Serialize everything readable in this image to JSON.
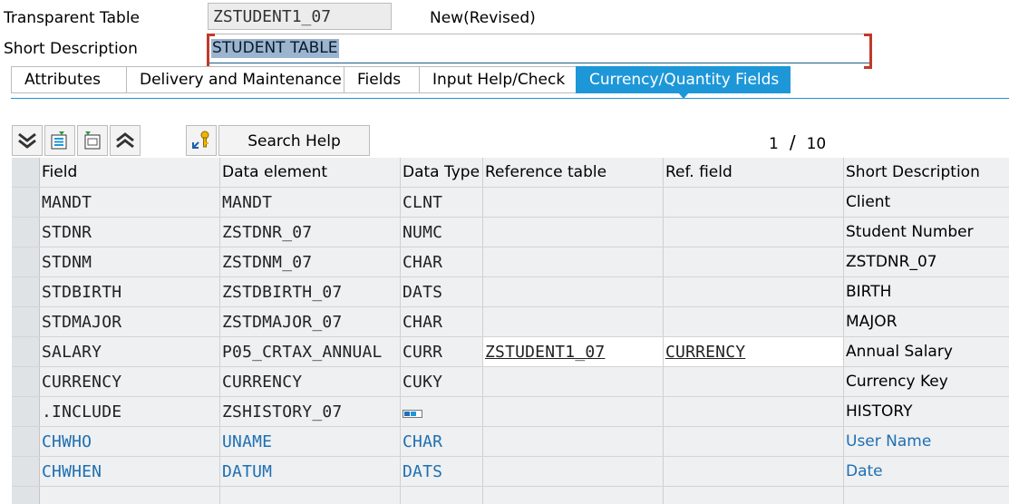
{
  "header": {
    "table_label": "Transparent Table",
    "table_name": "ZSTUDENT1_07",
    "status": "New(Revised)",
    "desc_label": "Short Description",
    "desc_value": "STUDENT TABLE"
  },
  "tabs": [
    {
      "label": "Attributes"
    },
    {
      "label": "Delivery and Maintenance"
    },
    {
      "label": "Fields"
    },
    {
      "label": "Input Help/Check"
    },
    {
      "label": "Currency/Quantity Fields"
    }
  ],
  "toolbar": {
    "search_help": "Search Help",
    "page_current": "1",
    "page_sep": "/",
    "page_total": "10"
  },
  "icons": {
    "collapse_all": "double-chevron-down-icon",
    "insert_row": "insert-row-icon",
    "delete_row": "delete-row-icon",
    "expand_all": "double-chevron-up-icon",
    "search_help": "search-help-key-icon",
    "include": "include-structure-icon"
  },
  "colors": {
    "accent": "#1e97d9",
    "included_text": "#1f6fb2"
  },
  "columns": [
    "Field",
    "Data element",
    "Data Type",
    "Reference table",
    "Ref. field",
    "Short Description"
  ],
  "rows": [
    {
      "field": "MANDT",
      "de": "MANDT",
      "dt": "CLNT",
      "ref": "",
      "rf": "",
      "sd": ""
    },
    {
      "field": "STDNR",
      "de": "ZSTDNR_07",
      "dt": "NUMC",
      "ref": "",
      "rf": "",
      "sd": "Student Number"
    },
    {
      "field": "STDNM",
      "de": "ZSTDNM_07",
      "dt": "CHAR",
      "ref": "",
      "rf": "",
      "sd": "ZSTDNR_07"
    },
    {
      "field": "STDBIRTH",
      "de": "ZSTDBIRTH_07",
      "dt": "DATS",
      "ref": "",
      "rf": "",
      "sd": "BIRTH"
    },
    {
      "field": "STDMAJOR",
      "de": "ZSTDMAJOR_07",
      "dt": "CHAR",
      "ref": "",
      "rf": "",
      "sd": "MAJOR"
    },
    {
      "field": "SALARY",
      "de": "P05_CRTAX_ANNUAL",
      "dt": "CURR",
      "ref": "ZSTUDENT1_07",
      "rf": "CURRENCY",
      "sd": "Annual Salary"
    },
    {
      "field": "CURRENCY",
      "de": "CURRENCY",
      "dt": "CUKY",
      "ref": "",
      "rf": "",
      "sd": "Currency Key"
    },
    {
      "field": ".INCLUDE",
      "de": "ZSHISTORY_07",
      "dt": "",
      "ref": "",
      "rf": "",
      "sd": "HISTORY"
    },
    {
      "field": "CHWHO",
      "de": "UNAME",
      "dt": "CHAR",
      "ref": "",
      "rf": "",
      "sd": "User Name"
    },
    {
      "field": "CHWHEN",
      "de": "DATUM",
      "dt": "DATS",
      "ref": "",
      "rf": "",
      "sd": "Date"
    }
  ],
  "row0_sd": "Client"
}
